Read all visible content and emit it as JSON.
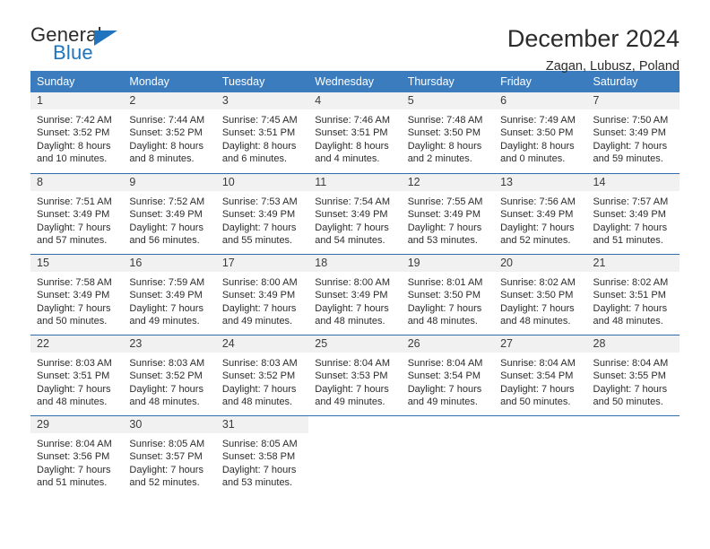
{
  "logo": {
    "primary_text": "General",
    "secondary_text": "Blue",
    "accent_color": "#1f74bd",
    "triangle_icon": "triangle-icon"
  },
  "header": {
    "title": "December 2024",
    "subtitle": "Zagan, Lubusz, Poland"
  },
  "calendar": {
    "header_bg": "#3a7cbe",
    "day_band_bg": "#f1f1f1",
    "row_divider": "#2f6fae",
    "weekdays": [
      "Sunday",
      "Monday",
      "Tuesday",
      "Wednesday",
      "Thursday",
      "Friday",
      "Saturday"
    ],
    "weeks": [
      [
        {
          "day": "1",
          "sunrise": "Sunrise: 7:42 AM",
          "sunset": "Sunset: 3:52 PM",
          "daylight_line1": "Daylight: 8 hours",
          "daylight_line2": "and 10 minutes."
        },
        {
          "day": "2",
          "sunrise": "Sunrise: 7:44 AM",
          "sunset": "Sunset: 3:52 PM",
          "daylight_line1": "Daylight: 8 hours",
          "daylight_line2": "and 8 minutes."
        },
        {
          "day": "3",
          "sunrise": "Sunrise: 7:45 AM",
          "sunset": "Sunset: 3:51 PM",
          "daylight_line1": "Daylight: 8 hours",
          "daylight_line2": "and 6 minutes."
        },
        {
          "day": "4",
          "sunrise": "Sunrise: 7:46 AM",
          "sunset": "Sunset: 3:51 PM",
          "daylight_line1": "Daylight: 8 hours",
          "daylight_line2": "and 4 minutes."
        },
        {
          "day": "5",
          "sunrise": "Sunrise: 7:48 AM",
          "sunset": "Sunset: 3:50 PM",
          "daylight_line1": "Daylight: 8 hours",
          "daylight_line2": "and 2 minutes."
        },
        {
          "day": "6",
          "sunrise": "Sunrise: 7:49 AM",
          "sunset": "Sunset: 3:50 PM",
          "daylight_line1": "Daylight: 8 hours",
          "daylight_line2": "and 0 minutes."
        },
        {
          "day": "7",
          "sunrise": "Sunrise: 7:50 AM",
          "sunset": "Sunset: 3:49 PM",
          "daylight_line1": "Daylight: 7 hours",
          "daylight_line2": "and 59 minutes."
        }
      ],
      [
        {
          "day": "8",
          "sunrise": "Sunrise: 7:51 AM",
          "sunset": "Sunset: 3:49 PM",
          "daylight_line1": "Daylight: 7 hours",
          "daylight_line2": "and 57 minutes."
        },
        {
          "day": "9",
          "sunrise": "Sunrise: 7:52 AM",
          "sunset": "Sunset: 3:49 PM",
          "daylight_line1": "Daylight: 7 hours",
          "daylight_line2": "and 56 minutes."
        },
        {
          "day": "10",
          "sunrise": "Sunrise: 7:53 AM",
          "sunset": "Sunset: 3:49 PM",
          "daylight_line1": "Daylight: 7 hours",
          "daylight_line2": "and 55 minutes."
        },
        {
          "day": "11",
          "sunrise": "Sunrise: 7:54 AM",
          "sunset": "Sunset: 3:49 PM",
          "daylight_line1": "Daylight: 7 hours",
          "daylight_line2": "and 54 minutes."
        },
        {
          "day": "12",
          "sunrise": "Sunrise: 7:55 AM",
          "sunset": "Sunset: 3:49 PM",
          "daylight_line1": "Daylight: 7 hours",
          "daylight_line2": "and 53 minutes."
        },
        {
          "day": "13",
          "sunrise": "Sunrise: 7:56 AM",
          "sunset": "Sunset: 3:49 PM",
          "daylight_line1": "Daylight: 7 hours",
          "daylight_line2": "and 52 minutes."
        },
        {
          "day": "14",
          "sunrise": "Sunrise: 7:57 AM",
          "sunset": "Sunset: 3:49 PM",
          "daylight_line1": "Daylight: 7 hours",
          "daylight_line2": "and 51 minutes."
        }
      ],
      [
        {
          "day": "15",
          "sunrise": "Sunrise: 7:58 AM",
          "sunset": "Sunset: 3:49 PM",
          "daylight_line1": "Daylight: 7 hours",
          "daylight_line2": "and 50 minutes."
        },
        {
          "day": "16",
          "sunrise": "Sunrise: 7:59 AM",
          "sunset": "Sunset: 3:49 PM",
          "daylight_line1": "Daylight: 7 hours",
          "daylight_line2": "and 49 minutes."
        },
        {
          "day": "17",
          "sunrise": "Sunrise: 8:00 AM",
          "sunset": "Sunset: 3:49 PM",
          "daylight_line1": "Daylight: 7 hours",
          "daylight_line2": "and 49 minutes."
        },
        {
          "day": "18",
          "sunrise": "Sunrise: 8:00 AM",
          "sunset": "Sunset: 3:49 PM",
          "daylight_line1": "Daylight: 7 hours",
          "daylight_line2": "and 48 minutes."
        },
        {
          "day": "19",
          "sunrise": "Sunrise: 8:01 AM",
          "sunset": "Sunset: 3:50 PM",
          "daylight_line1": "Daylight: 7 hours",
          "daylight_line2": "and 48 minutes."
        },
        {
          "day": "20",
          "sunrise": "Sunrise: 8:02 AM",
          "sunset": "Sunset: 3:50 PM",
          "daylight_line1": "Daylight: 7 hours",
          "daylight_line2": "and 48 minutes."
        },
        {
          "day": "21",
          "sunrise": "Sunrise: 8:02 AM",
          "sunset": "Sunset: 3:51 PM",
          "daylight_line1": "Daylight: 7 hours",
          "daylight_line2": "and 48 minutes."
        }
      ],
      [
        {
          "day": "22",
          "sunrise": "Sunrise: 8:03 AM",
          "sunset": "Sunset: 3:51 PM",
          "daylight_line1": "Daylight: 7 hours",
          "daylight_line2": "and 48 minutes."
        },
        {
          "day": "23",
          "sunrise": "Sunrise: 8:03 AM",
          "sunset": "Sunset: 3:52 PM",
          "daylight_line1": "Daylight: 7 hours",
          "daylight_line2": "and 48 minutes."
        },
        {
          "day": "24",
          "sunrise": "Sunrise: 8:03 AM",
          "sunset": "Sunset: 3:52 PM",
          "daylight_line1": "Daylight: 7 hours",
          "daylight_line2": "and 48 minutes."
        },
        {
          "day": "25",
          "sunrise": "Sunrise: 8:04 AM",
          "sunset": "Sunset: 3:53 PM",
          "daylight_line1": "Daylight: 7 hours",
          "daylight_line2": "and 49 minutes."
        },
        {
          "day": "26",
          "sunrise": "Sunrise: 8:04 AM",
          "sunset": "Sunset: 3:54 PM",
          "daylight_line1": "Daylight: 7 hours",
          "daylight_line2": "and 49 minutes."
        },
        {
          "day": "27",
          "sunrise": "Sunrise: 8:04 AM",
          "sunset": "Sunset: 3:54 PM",
          "daylight_line1": "Daylight: 7 hours",
          "daylight_line2": "and 50 minutes."
        },
        {
          "day": "28",
          "sunrise": "Sunrise: 8:04 AM",
          "sunset": "Sunset: 3:55 PM",
          "daylight_line1": "Daylight: 7 hours",
          "daylight_line2": "and 50 minutes."
        }
      ],
      [
        {
          "day": "29",
          "sunrise": "Sunrise: 8:04 AM",
          "sunset": "Sunset: 3:56 PM",
          "daylight_line1": "Daylight: 7 hours",
          "daylight_line2": "and 51 minutes."
        },
        {
          "day": "30",
          "sunrise": "Sunrise: 8:05 AM",
          "sunset": "Sunset: 3:57 PM",
          "daylight_line1": "Daylight: 7 hours",
          "daylight_line2": "and 52 minutes."
        },
        {
          "day": "31",
          "sunrise": "Sunrise: 8:05 AM",
          "sunset": "Sunset: 3:58 PM",
          "daylight_line1": "Daylight: 7 hours",
          "daylight_line2": "and 53 minutes."
        },
        {
          "day": "",
          "sunrise": "",
          "sunset": "",
          "daylight_line1": "",
          "daylight_line2": ""
        },
        {
          "day": "",
          "sunrise": "",
          "sunset": "",
          "daylight_line1": "",
          "daylight_line2": ""
        },
        {
          "day": "",
          "sunrise": "",
          "sunset": "",
          "daylight_line1": "",
          "daylight_line2": ""
        },
        {
          "day": "",
          "sunrise": "",
          "sunset": "",
          "daylight_line1": "",
          "daylight_line2": ""
        }
      ]
    ]
  }
}
